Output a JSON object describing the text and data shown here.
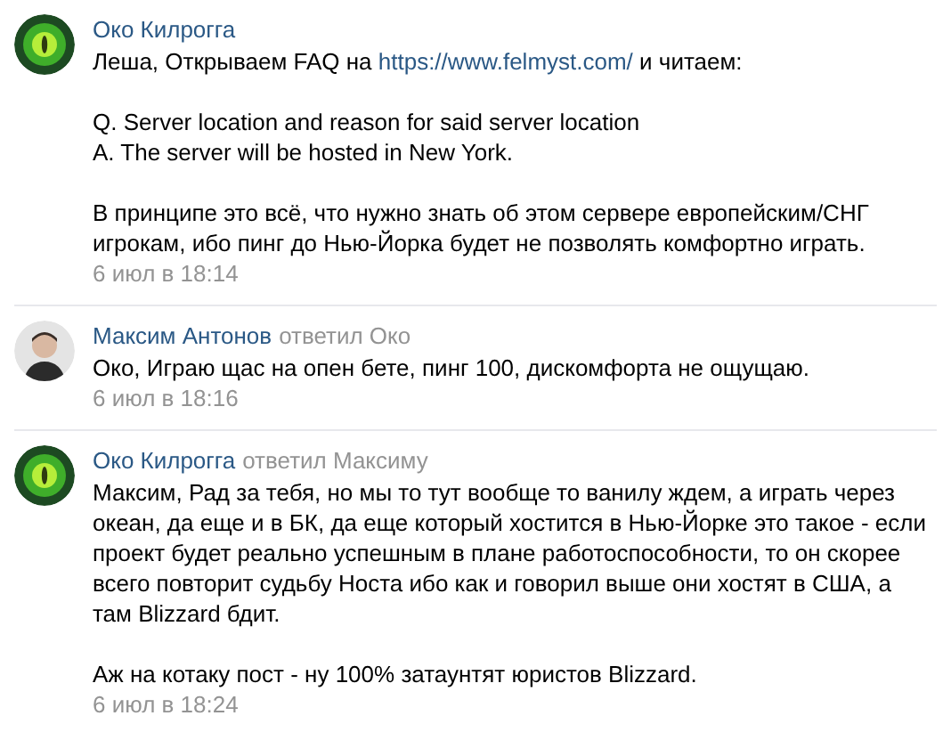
{
  "comments": [
    {
      "kind": "eye",
      "author": "Око Килрогга",
      "paragraphs": [
        [
          [
            {
              "kind": "text",
              "text": "Леша, Открываем FAQ на "
            },
            {
              "kind": "link",
              "text": "https://www.felmyst.com/"
            },
            {
              "kind": "text",
              "text": " и читаем:"
            }
          ]
        ],
        [
          [
            {
              "kind": "text",
              "text": "Q. Server location and reason for said server location"
            }
          ],
          [
            {
              "kind": "text",
              "text": "A. The server will be hosted in New York."
            }
          ]
        ],
        [
          [
            {
              "kind": "text",
              "text": "В принципе это всё, что нужно знать об этом сервере европейским/СНГ игрокам, ибо пинг до Нью-Йорка будет не позволять комфортно играть."
            }
          ]
        ]
      ],
      "date": "6 июл в 18:14"
    },
    {
      "kind": "person",
      "author": "Максим Антонов",
      "reply_to": "ответил Око",
      "paragraphs": [
        [
          [
            {
              "kind": "text",
              "text": "Око, Играю щас на опен бете, пинг 100, дискомфорта не ощущаю."
            }
          ]
        ]
      ],
      "date": "6 июл в 18:16"
    },
    {
      "kind": "eye",
      "author": "Око Килрогга",
      "reply_to": "ответил Максиму",
      "paragraphs": [
        [
          [
            {
              "kind": "text",
              "text": "Максим, Рад за тебя, но мы то тут вообще то ванилу ждем, а играть через океан, да еще и в БК, да еще который хостится в Нью-Йорке это такое - если проект будет реально успешным в плане работоспособности, то он скорее всего повторит судьбу Носта ибо как и говорил выше они хостят в США, а там Blizzard бдит."
            }
          ]
        ],
        [
          [
            {
              "kind": "text",
              "text": "Аж на котаку пост - ну 100% затаунтят юристов Blizzard."
            }
          ]
        ]
      ],
      "date": "6 июл в 18:24"
    }
  ]
}
